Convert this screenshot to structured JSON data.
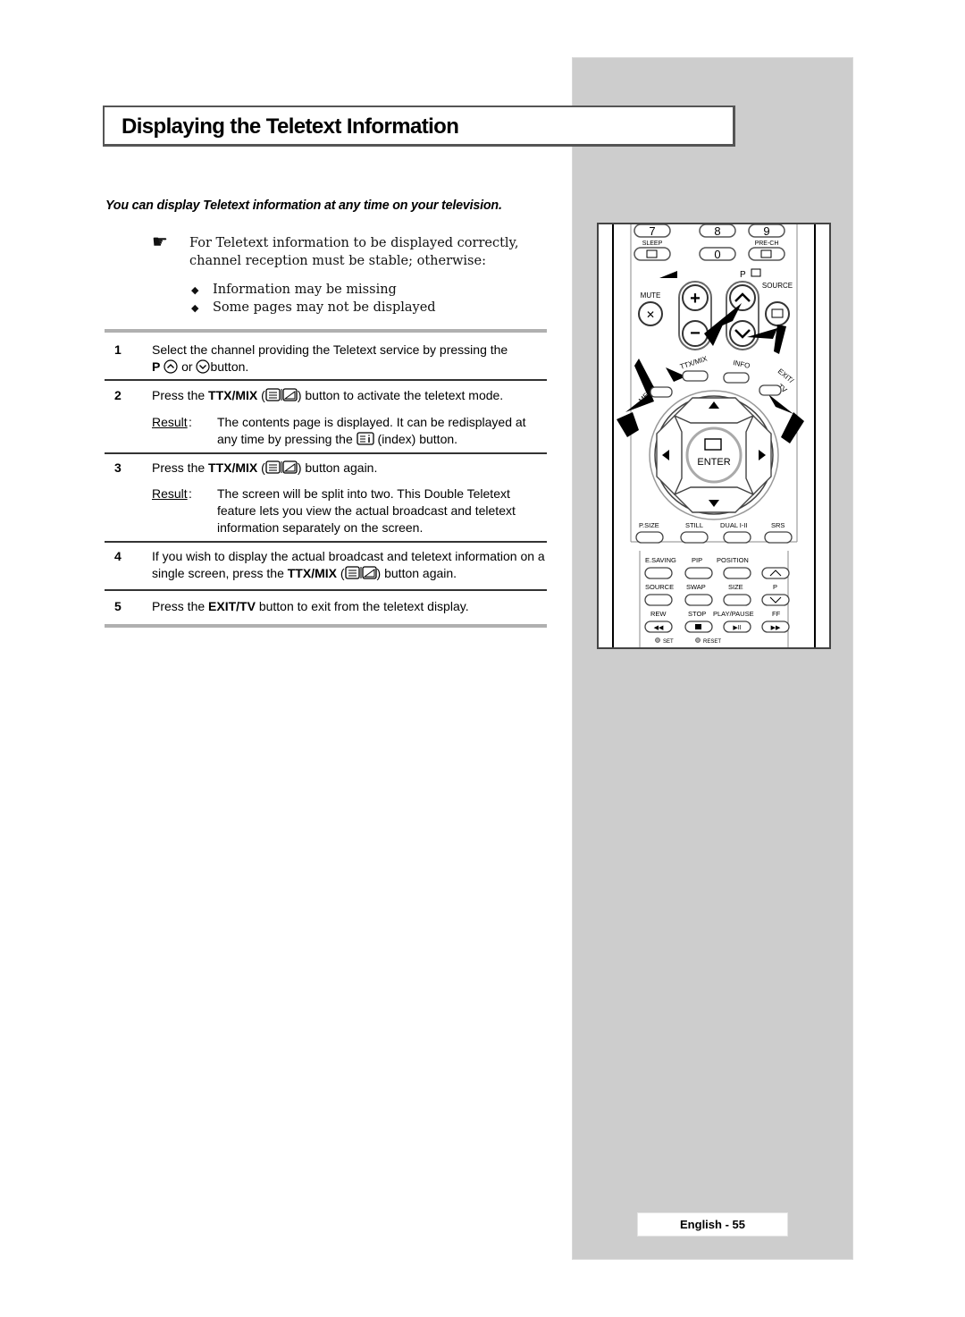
{
  "page": {
    "title": "Displaying the Teletext Information",
    "intro": "You can display Teletext information at any time on your television.",
    "note": {
      "icon": "pointing-hand-icon",
      "text": "For Teletext information to be displayed correctly, channel reception must be stable; otherwise:",
      "bullets": [
        "Information may be missing",
        "Some pages may not be displayed"
      ]
    },
    "steps": [
      {
        "number": "1",
        "parts": [
          "Select the channel providing the Teletext service by pressing the",
          "P",
          "or",
          "button."
        ]
      },
      {
        "number": "2",
        "pre": "Press the",
        "key": "TTX/MIX",
        "post": "button to activate the teletext mode.",
        "result_label": "Result",
        "result_pre": "The contents page is displayed. It can be redisplayed at any time by pressing the",
        "result_post": "(index) button."
      },
      {
        "number": "3",
        "pre": "Press the",
        "key": "TTX/MIX",
        "post": "button again.",
        "result_label": "Result",
        "result_text": "The screen will be split into two. This Double Teletext feature lets you view the actual broadcast and teletext information separately on the screen."
      },
      {
        "number": "4",
        "pre": "If you wish to display the actual broadcast and teletext information on a single screen, press the",
        "key": "TTX/MIX",
        "post": "button again."
      },
      {
        "number": "5",
        "pre": "Press the",
        "key": "EXIT/TV",
        "post": "button to exit from the teletext display."
      }
    ],
    "footer": "English - 55"
  },
  "remote": {
    "row_digits": [
      "7",
      "8",
      "9"
    ],
    "sleep": "SLEEP",
    "zero": "0",
    "prech": "PRE-CH",
    "p": "P",
    "source": "SOURCE",
    "mute": "MUTE",
    "ttxmix": "TTX/MIX",
    "info": "INFO",
    "menu": "MENU",
    "exit": "EXIT/",
    "tv": "TV",
    "enter": "ENTER",
    "row_a": [
      "P.SIZE",
      "STILL",
      "DUAL I-II",
      "SRS"
    ],
    "row_b": [
      "E.SAVING",
      "PIP",
      "POSITION",
      ""
    ],
    "row_c": [
      "SOURCE",
      "SWAP",
      "SIZE",
      "P"
    ],
    "row_d": [
      "REW",
      "STOP",
      "PLAY/PAUSE",
      "FF"
    ],
    "set": "SET",
    "reset": "RESET"
  }
}
